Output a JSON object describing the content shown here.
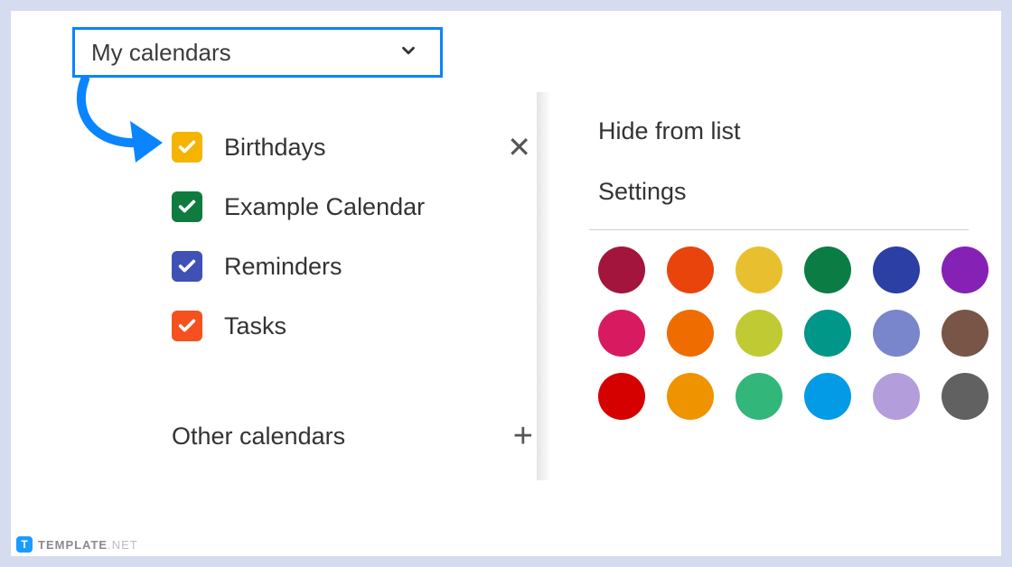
{
  "header": {
    "title": "My calendars"
  },
  "calendars": [
    {
      "label": "Birthdays",
      "color": "#f4b400",
      "showClose": true
    },
    {
      "label": "Example Calendar",
      "color": "#0f7b3e",
      "showClose": false
    },
    {
      "label": "Reminders",
      "color": "#3f51b5",
      "showClose": false
    },
    {
      "label": "Tasks",
      "color": "#f4511e",
      "showClose": false
    }
  ],
  "otherCalendars": {
    "label": "Other calendars"
  },
  "popup": {
    "hide": "Hide from list",
    "settings": "Settings",
    "swatches": [
      "#a3153d",
      "#e8440b",
      "#e8c02f",
      "#0c7c45",
      "#2b3fa4",
      "#8621b5",
      "#d81b60",
      "#ef6c00",
      "#c0ca33",
      "#009688",
      "#7986cb",
      "#795548",
      "#d50000",
      "#f09300",
      "#33b679",
      "#039be5",
      "#b39ddb",
      "#616161"
    ]
  },
  "watermark": {
    "brand": "TEMPLATE",
    "tld": ".NET",
    "logoLetter": "T"
  }
}
